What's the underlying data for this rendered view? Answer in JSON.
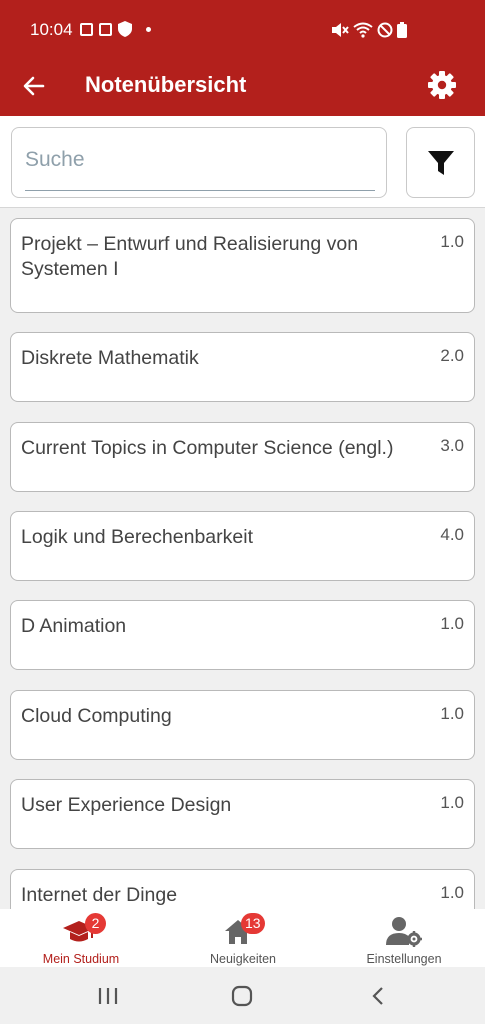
{
  "status_bar": {
    "time": "10:04"
  },
  "app_bar": {
    "title": "Notenübersicht"
  },
  "search": {
    "placeholder": "Suche",
    "value": ""
  },
  "courses": [
    {
      "name": "Projekt – Entwurf und Realisierung von Systemen I",
      "grade": "1.0"
    },
    {
      "name": "Diskrete Mathematik",
      "grade": "2.0"
    },
    {
      "name": "Current Topics in Computer Science (engl.)",
      "grade": "3.0"
    },
    {
      "name": "Logik und Berechenbarkeit",
      "grade": "4.0"
    },
    {
      "name": "D Animation",
      "grade": "1.0"
    },
    {
      "name": "Cloud Computing",
      "grade": "1.0"
    },
    {
      "name": "User Experience Design",
      "grade": "1.0"
    },
    {
      "name": "Internet der Dinge",
      "grade": "1.0"
    }
  ],
  "bottom_nav": [
    {
      "label": "Mein Studium",
      "icon": "graduation-cap-icon",
      "badge": "2",
      "active": true
    },
    {
      "label": "Neuigkeiten",
      "icon": "home-icon",
      "badge": "13",
      "active": false
    },
    {
      "label": "Einstellungen",
      "icon": "user-settings-icon",
      "badge": "",
      "active": false
    }
  ],
  "colors": {
    "primary": "#b3201c",
    "badge": "#e53935",
    "background": "#f0f0f0"
  }
}
